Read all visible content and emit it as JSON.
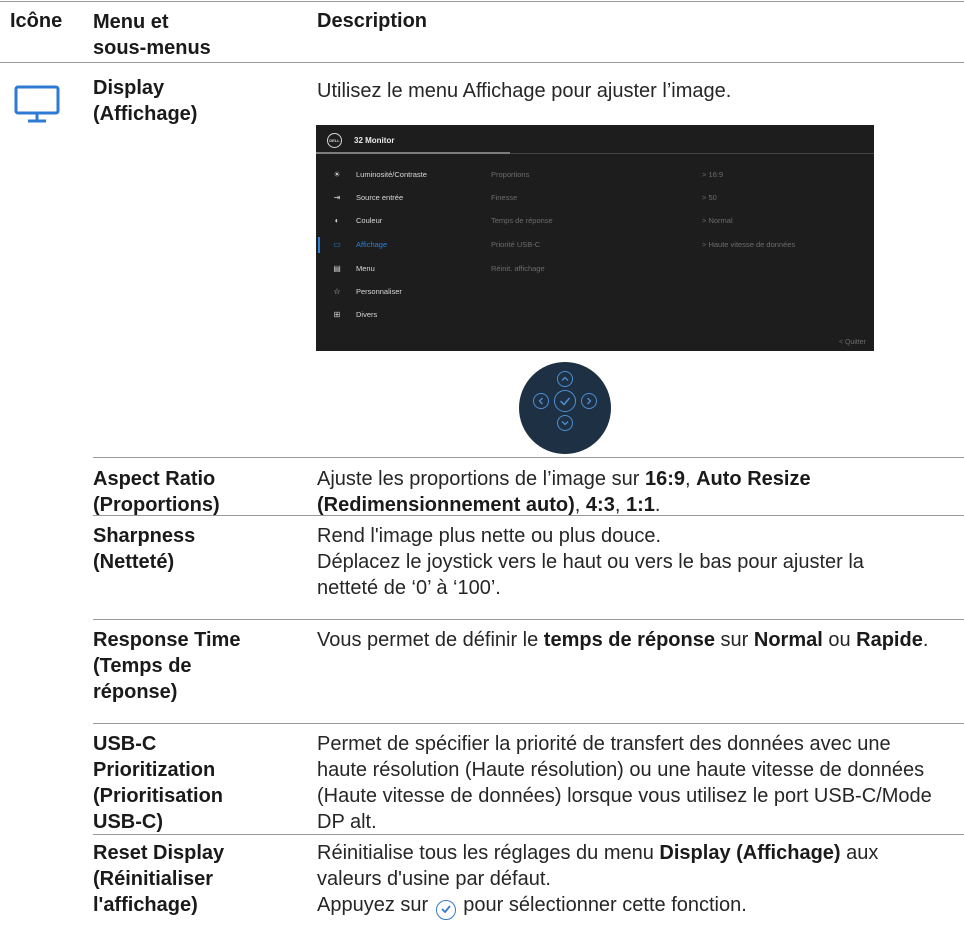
{
  "header": {
    "icon_col": "Icône",
    "menu_col": "Menu et\nsous-menus",
    "desc_col": "Description"
  },
  "display_row": {
    "icon": "monitor-icon",
    "term": "Display\n(Affichage)",
    "desc": "Utilisez le menu Affichage pour ajuster l’image."
  },
  "osd": {
    "logo": "DELL",
    "title": "32 Monitor",
    "menu": [
      {
        "icon": "brightness-icon",
        "glyph": "☀",
        "label": "Luminosité/Contraste"
      },
      {
        "icon": "input-source-icon",
        "glyph": "⇥",
        "label": "Source entrée"
      },
      {
        "icon": "color-icon",
        "glyph": "◐",
        "label": "Couleur"
      },
      {
        "icon": "display-icon",
        "glyph": "▭",
        "label": "Affichage"
      },
      {
        "icon": "menu-icon",
        "glyph": "▤",
        "label": "Menu"
      },
      {
        "icon": "star-icon",
        "glyph": "☆",
        "label": "Personnaliser"
      },
      {
        "icon": "others-icon",
        "glyph": "⊞",
        "label": "Divers"
      }
    ],
    "active_index": 3,
    "submenu": [
      {
        "label": "Proportions",
        "value": ">  16:9"
      },
      {
        "label": "Finesse",
        "value": ">  50"
      },
      {
        "label": "Temps de réponse",
        "value": ">  Normal"
      },
      {
        "label": "Priorité USB-C",
        "value": ">  Haute vitesse de données"
      },
      {
        "label": "Réinit. affichage",
        "value": ""
      }
    ],
    "quit": "<  Quitter"
  },
  "joystick": {
    "up": "^",
    "left": "<",
    "center": "✓",
    "right": ">",
    "down": "v"
  },
  "rows": [
    {
      "term": "Aspect Ratio\n(Proportions)"
    },
    {
      "term": "Sharpness\n(Netteté)"
    },
    {
      "term": "Response Time\n(Temps de\nréponse)"
    },
    {
      "term": "USB-C\nPrioritization\n(Prioritisation\nUSB-C)"
    },
    {
      "term": "Reset Display\n(Réinitialiser\nl'affichage)"
    }
  ],
  "aspect": {
    "t1": "Ajuste les proportions de l’image sur ",
    "b1": "16:9",
    "t2": ", ",
    "b2": "Auto Resize (Redimensionnement auto)",
    "t3": ", ",
    "b3": "4:3",
    "t4": ", ",
    "b4": "1:1",
    "t5": "."
  },
  "sharpness": {
    "line1": "Rend l'image plus nette ou plus douce.",
    "line2": "Déplacez le joystick vers le haut ou vers le bas pour ajuster la netteté de ‘0’ à ‘100’."
  },
  "response": {
    "t1": "Vous permet de définir le ",
    "b1": "temps de réponse",
    "t2": " sur ",
    "b2": "Normal",
    "t3": " ou ",
    "b3": "Rapide",
    "t4": "."
  },
  "usbc": {
    "text": "Permet de spécifier la priorité de transfert des données avec une haute résolution (Haute résolution) ou une haute vitesse de données (Haute vitesse de données) lorsque vous utilisez le port USB-C/Mode DP alt."
  },
  "reset": {
    "t1": "Réinitialise tous les réglages du menu ",
    "b1": "Display (Affichage)",
    "t2": " aux valeurs d'usine par défaut.",
    "t3": "Appuyez sur ",
    "icon": "checkmark-circle-icon",
    "t4": " pour sélectionner cette fonction."
  }
}
